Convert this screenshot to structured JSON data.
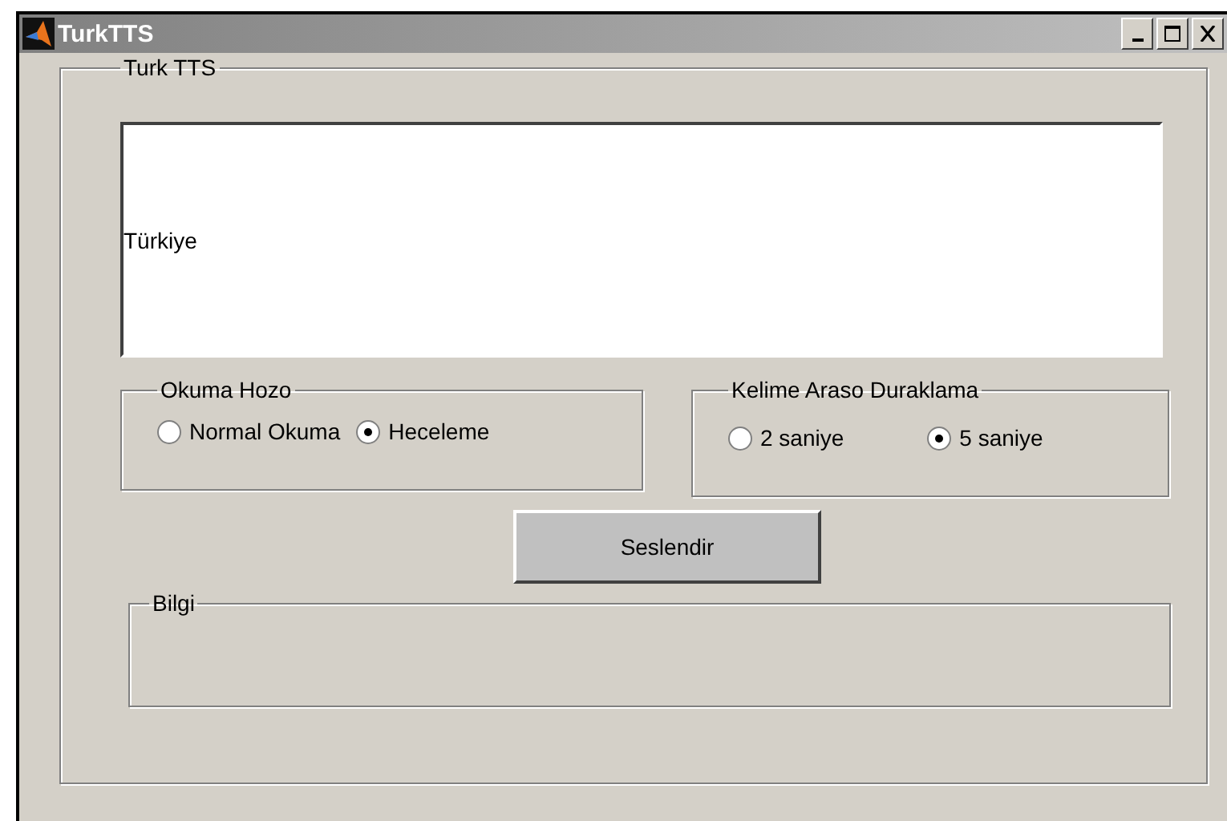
{
  "window": {
    "title": "TurkTTS"
  },
  "panel": {
    "title": "Turk TTS"
  },
  "text_box": {
    "value": "Türkiye"
  },
  "reading_mode": {
    "title": "Okuma Hozo",
    "options": [
      {
        "label": "Normal Okuma",
        "selected": false
      },
      {
        "label": "Heceleme",
        "selected": true
      }
    ]
  },
  "pause": {
    "title": "Kelime Araso Duraklama",
    "options": [
      {
        "label": "2 saniye",
        "selected": false
      },
      {
        "label": "5 saniye",
        "selected": true
      }
    ]
  },
  "button": {
    "label": "Seslendir"
  },
  "info": {
    "title": "Bilgi"
  }
}
